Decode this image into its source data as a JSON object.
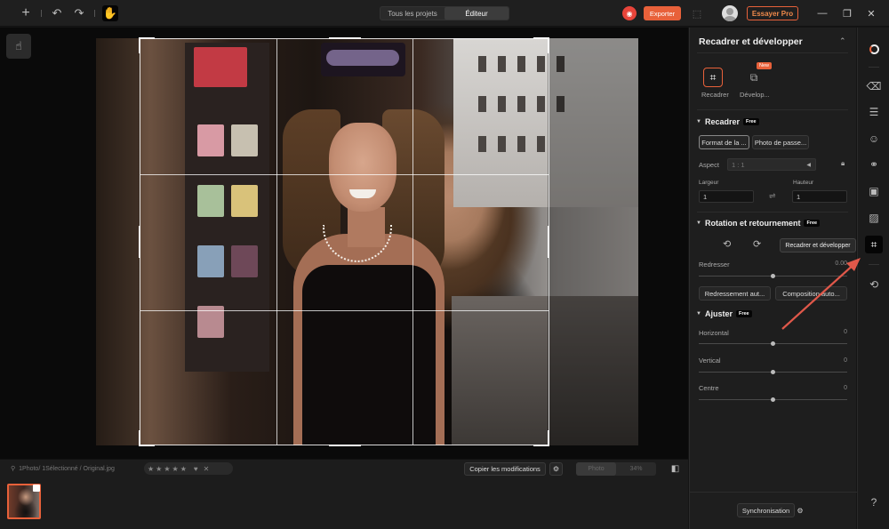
{
  "topbar": {
    "tabs": [
      {
        "label": "Tous les projets",
        "active": false
      },
      {
        "label": "Éditeur",
        "active": true
      }
    ],
    "export_label": "Exporter",
    "pro_label": "Essayer Pro",
    "icons": [
      "plus-icon",
      "undo-icon",
      "redo-icon",
      "hand-icon",
      "ai-icon",
      "share-icon",
      "minimize-icon",
      "maximize-icon",
      "close-icon"
    ]
  },
  "panel": {
    "title": "Recadrer et développer",
    "modes": [
      {
        "label": "Recadrer",
        "active": true
      },
      {
        "label": "Dévelop...",
        "active": false,
        "badge": "New"
      }
    ],
    "crop": {
      "title": "Recadrer",
      "badge": "Free",
      "buttons": [
        "Format de la ...",
        "Photo de passe..."
      ],
      "aspect_label": "Aspect",
      "aspect_value": "1 : 1",
      "width_label": "Largeur",
      "height_label": "Hauteur",
      "width_value": "1",
      "height_value": "1"
    },
    "rotation": {
      "title": "Rotation et retournement",
      "badge": "Free",
      "straighten_label": "Redresser",
      "straighten_value": "0.00",
      "buttons": [
        "Redressement aut...",
        "Composition auto..."
      ]
    },
    "adjust": {
      "title": "Ajuster",
      "badge": "Free",
      "sliders": [
        {
          "label": "Horizontal",
          "value": "0"
        },
        {
          "label": "Vertical",
          "value": "0"
        },
        {
          "label": "Centre",
          "value": "0"
        }
      ]
    },
    "tooltip": "Recadrer et développer",
    "sync_label": "Synchronisation"
  },
  "filmstrip": {
    "path": "1Photo/ 1Sélectionné / Original.jpg",
    "copy_label": "Copier les modifications",
    "view_options": [
      "Photo",
      "34%"
    ]
  },
  "colors": {
    "accent": "#e8613a",
    "ai_red": "#e8443a",
    "panel_bg": "#1e1e1e"
  }
}
